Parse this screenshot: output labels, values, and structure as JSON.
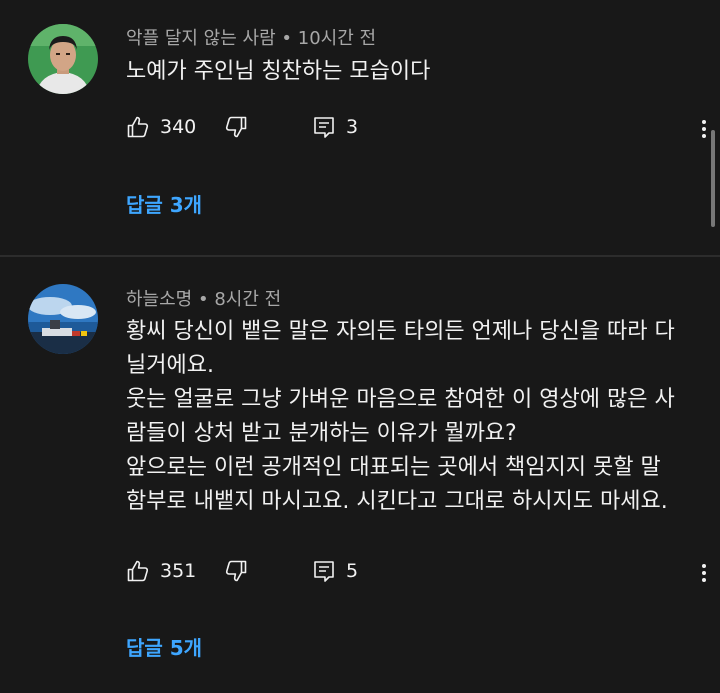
{
  "comments": [
    {
      "author": "악플 달지 않는 사람",
      "time": "10시간 전",
      "lines": [
        "노예가 주인님 칭찬하는 모습이다"
      ],
      "likes": "340",
      "reply_count": "3",
      "replies_link": "답글 3개",
      "avatar_icon": "person-portrait-avatar"
    },
    {
      "author": "하늘소명",
      "time": "8시간 전",
      "lines": [
        "황씨 당신이 뱉은 말은 자의든 타의든 언제나 당신을 따라 다",
        "닐거에요.",
        "웃는 얼굴로 그냥 가벼운 마음으로 참여한 이 영상에 많은 사",
        "람들이 상처 받고 분개하는 이유가 뭘까요?",
        "앞으로는 이런 공개적인 대표되는 곳에서 책임지지 못할 말",
        "함부로 내뱉지 마시고요. 시킨다고 그대로 하시지도 마세요."
      ],
      "likes": "351",
      "reply_count": "5",
      "replies_link": "답글 5개",
      "avatar_icon": "sky-landscape-avatar"
    }
  ],
  "meta_separator": "•",
  "colors": {
    "background": "#181818",
    "text": "#f1f1f1",
    "secondary_text": "#a7a7a7",
    "link": "#3ea6ff",
    "divider": "#2c2c2c"
  }
}
